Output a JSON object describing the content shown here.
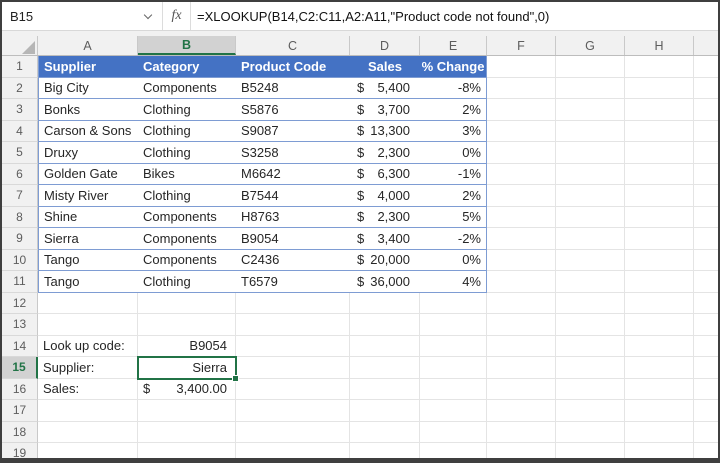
{
  "formula_bar": {
    "name_box_value": "B15",
    "fx_label": "fx",
    "formula": "=XLOOKUP(B14,C2:C11,A2:A11,\"Product code not found\",0)"
  },
  "column_headers": [
    "A",
    "B",
    "C",
    "D",
    "E",
    "F",
    "G",
    "H"
  ],
  "selection": {
    "cell": "B15",
    "column": "B",
    "row": 15
  },
  "visible_row_count": 19,
  "table": {
    "range": "A1:E11",
    "header_labels": [
      "Supplier",
      "Category",
      "Product Code",
      "Sales",
      "% Change"
    ],
    "currency_symbol": "$",
    "rows": [
      {
        "supplier": "Big City",
        "category": "Components",
        "product_code": "B5248",
        "sales": "5,400",
        "change": "-8%"
      },
      {
        "supplier": "Bonks",
        "category": "Clothing",
        "product_code": "S5876",
        "sales": "3,700",
        "change": "2%"
      },
      {
        "supplier": "Carson & Sons",
        "category": "Clothing",
        "product_code": "S9087",
        "sales": "13,300",
        "change": "3%"
      },
      {
        "supplier": "Druxy",
        "category": "Clothing",
        "product_code": "S3258",
        "sales": "2,300",
        "change": "0%"
      },
      {
        "supplier": "Golden Gate",
        "category": "Bikes",
        "product_code": "M6642",
        "sales": "6,300",
        "change": "-1%"
      },
      {
        "supplier": "Misty River",
        "category": "Clothing",
        "product_code": "B7544",
        "sales": "4,000",
        "change": "2%"
      },
      {
        "supplier": "Shine",
        "category": "Components",
        "product_code": "H8763",
        "sales": "2,300",
        "change": "5%"
      },
      {
        "supplier": "Sierra",
        "category": "Components",
        "product_code": "B9054",
        "sales": "3,400",
        "change": "-2%"
      },
      {
        "supplier": "Tango",
        "category": "Components",
        "product_code": "C2436",
        "sales": "20,000",
        "change": "0%"
      },
      {
        "supplier": "Tango",
        "category": "Clothing",
        "product_code": "T6579",
        "sales": "36,000",
        "change": "4%"
      }
    ]
  },
  "lookup_section": {
    "rows": [
      {
        "row": 14,
        "label": "Look up code:",
        "value": "B9054",
        "currency": false
      },
      {
        "row": 15,
        "label": "Supplier:",
        "value": "Sierra",
        "currency": false,
        "selected": true
      },
      {
        "row": 16,
        "label": "Sales:",
        "value": "3,400.00",
        "currency": true
      }
    ]
  },
  "colors": {
    "table_header_fill": "#4472C4",
    "table_border": "#7E9CD3",
    "selection_green": "#217346",
    "header_fill": "#F1F1F1",
    "selected_header_fill": "#D2D2D2",
    "gridline": "#E4E4E4",
    "frame": "#3F3F3F"
  }
}
